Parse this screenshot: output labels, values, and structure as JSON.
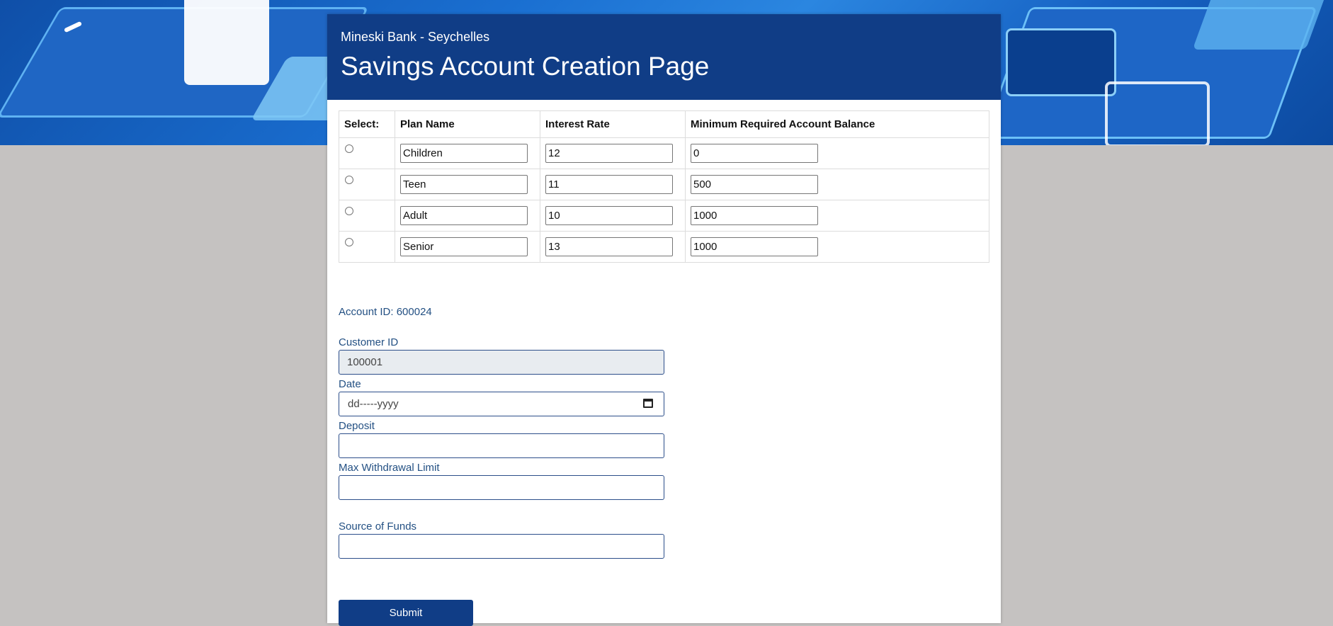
{
  "header": {
    "bank_name": "Mineski Bank - Seychelles",
    "title": "Savings Account Creation Page"
  },
  "plans_table": {
    "columns": [
      "Select:",
      "Plan Name",
      "Interest Rate",
      "Minimum Required Account Balance"
    ],
    "rows": [
      {
        "plan_name": "Children",
        "interest_rate": "12",
        "min_balance": "0"
      },
      {
        "plan_name": "Teen",
        "interest_rate": "11",
        "min_balance": "500"
      },
      {
        "plan_name": "Adult",
        "interest_rate": "10",
        "min_balance": "1000"
      },
      {
        "plan_name": "Senior",
        "interest_rate": "13",
        "min_balance": "1000"
      }
    ]
  },
  "form": {
    "account_id": "Account ID: 600024",
    "customer_id_label": "Customer ID",
    "customer_id_value": "100001",
    "date_label": "Date",
    "date_placeholder": "dd-----yyyy",
    "deposit_label": "Deposit",
    "max_withdrawal_label": "Max Withdrawal Limit",
    "source_of_funds_label": "Source of Funds",
    "submit_label": "Submit"
  },
  "colors": {
    "header_bg": "#103d86",
    "label_text": "#235083",
    "page_bg": "#c5c2c1"
  }
}
